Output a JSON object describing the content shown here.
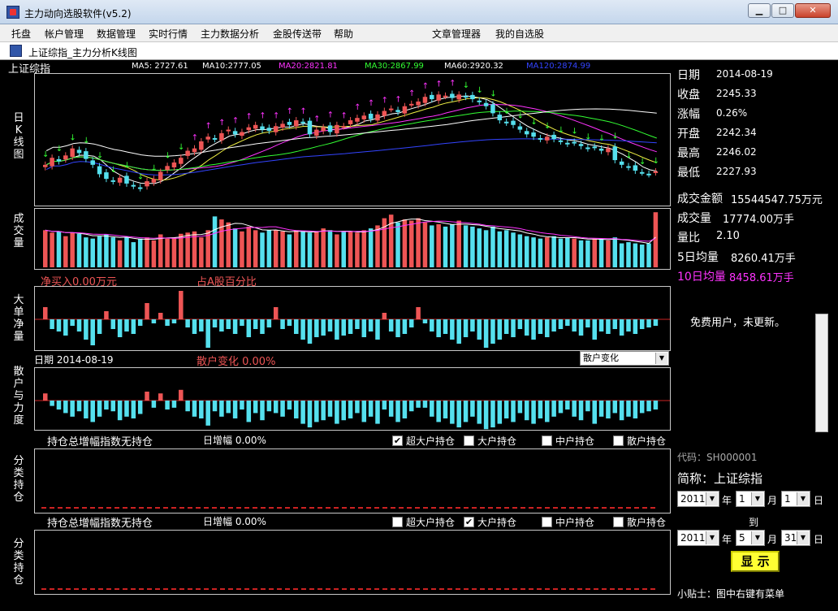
{
  "window": {
    "title": "主力动向选股软件(v5.2)",
    "min": "▁",
    "max": "□",
    "close": "✕"
  },
  "menu": [
    "托盘",
    "帐户管理",
    "数据管理",
    "实时行情",
    "主力数据分析",
    "金股传送带",
    "帮助",
    "文章管理器",
    "我的自选股"
  ],
  "subtitle": "上证综指_主力分析K线图",
  "stock_name": "上证综指",
  "ma": [
    {
      "label": "MA5: 2727.61",
      "color": "#ffffff"
    },
    {
      "label": "MA10:2777.05",
      "color": "#ffffff"
    },
    {
      "label": "MA20:2821.81",
      "color": "#ff33ff"
    },
    {
      "label": "MA30:2867.99",
      "color": "#33ff33"
    },
    {
      "label": "MA60:2920.32",
      "color": "#ffffff"
    },
    {
      "label": "MA120:2874.99",
      "color": "#3344ff"
    }
  ],
  "labels": {
    "kline": "日K线图",
    "volume": "成交量",
    "bignet": "大单净量",
    "retail": "散户与力度",
    "hold1": "分类持仓",
    "hold2": "分类持仓",
    "net_buy": "净买入0.00万元",
    "pct_a": "占A股百分比",
    "date_label": "日期 2014-08-19",
    "retail_change": "散户变化  0.00%",
    "retail_dropdown": "散户变化",
    "hold_title": "持仓总增幅指数无持仓",
    "day_inc": "日增幅  0.00%",
    "chk_super": "超大户持仓",
    "chk_big": "大户持仓",
    "chk_mid": "中户持仓",
    "chk_retail": "散户持仓",
    "chk1": [
      true,
      false,
      false,
      false
    ],
    "chk2": [
      false,
      true,
      false,
      false
    ]
  },
  "colors": {
    "up": "#ee5555",
    "down": "#55e0ee",
    "ma5": "#ffffff",
    "ma10": "#eeee44",
    "ma20": "#ff33ff",
    "ma30": "#33ff33",
    "ma60": "#ffffff",
    "ma120": "#3344ff",
    "buy": "#ff33ff",
    "sell": "#33ff33"
  },
  "side": {
    "rows": [
      {
        "k": "日期",
        "v": "2014-08-19"
      },
      {
        "k": "收盘",
        "v": "2245.33"
      },
      {
        "k": "涨幅",
        "v": "0.26%"
      },
      {
        "k": "开盘",
        "v": "2242.34"
      },
      {
        "k": "最高",
        "v": "2246.02"
      },
      {
        "k": "最低",
        "v": "2227.93"
      }
    ],
    "rows2": [
      {
        "k": "成交金额",
        "v": "15544547.75万元"
      },
      {
        "k": "成交量",
        "v": "17774.00万手"
      },
      {
        "k": "量比",
        "v": "2.10"
      },
      {
        "k": "5日均量",
        "v": "8260.41万手"
      },
      {
        "k": "10日均量",
        "v": "8458.61万手"
      }
    ],
    "notice": "免费用户，未更新。",
    "code": "代码：SH000001",
    "short_name": "简称：上证综指",
    "from": {
      "y": "2011",
      "m": "1",
      "d": "1"
    },
    "to": {
      "y": "2011",
      "m": "5",
      "d": "31"
    },
    "to_label": "到",
    "y": "年",
    "mo": "月",
    "d": "日",
    "show_btn": "显 示",
    "tip": "小贴士：图中右键有菜单"
  },
  "chart_data": {
    "type": "candlestick",
    "k_series_close": [
      2760,
      2790,
      2775,
      2800,
      2830,
      2810,
      2785,
      2760,
      2720,
      2700,
      2690,
      2705,
      2680,
      2670,
      2660,
      2690,
      2700,
      2730,
      2755,
      2770,
      2790,
      2820,
      2830,
      2860,
      2880,
      2870,
      2895,
      2910,
      2890,
      2900,
      2920,
      2930,
      2910,
      2905,
      2925,
      2935,
      2930,
      2950,
      2940,
      2890,
      2910,
      2920,
      2900,
      2930,
      2925,
      2950,
      2960,
      2970,
      2955,
      2975,
      2990,
      3000,
      2985,
      3010,
      3020,
      3030,
      3050,
      3040,
      3060,
      3055,
      3045,
      3060,
      3050,
      3040,
      3030,
      3010,
      2980,
      2950,
      2940,
      2930,
      2910,
      2890,
      2880,
      2870,
      2880,
      2870,
      2860,
      2850,
      2855,
      2840,
      2830,
      2835,
      2820,
      2830,
      2780,
      2760,
      2750,
      2735,
      2728,
      2720,
      2732
    ],
    "vol_series": [
      62,
      58,
      60,
      52,
      58,
      56,
      50,
      48,
      52,
      55,
      50,
      45,
      50,
      42,
      48,
      50,
      45,
      55,
      48,
      50,
      56,
      58,
      60,
      50,
      62,
      85,
      80,
      75,
      65,
      60,
      68,
      62,
      58,
      62,
      62,
      60,
      55,
      62,
      60,
      58,
      60,
      65,
      62,
      55,
      60,
      60,
      58,
      62,
      65,
      70,
      82,
      88,
      75,
      80,
      78,
      82,
      75,
      70,
      72,
      68,
      72,
      78,
      70,
      68,
      65,
      62,
      68,
      60,
      62,
      58,
      55,
      52,
      50,
      48,
      50,
      52,
      48,
      50,
      48,
      45,
      45,
      48,
      48,
      45,
      50,
      40,
      42,
      40,
      38,
      40,
      92
    ],
    "bignet_series": [
      15,
      -12,
      -15,
      -20,
      -8,
      -15,
      -25,
      -32,
      -18,
      10,
      -12,
      -22,
      -15,
      -18,
      -8,
      20,
      -5,
      8,
      -8,
      -5,
      35,
      -10,
      -18,
      -15,
      -35,
      -10,
      -15,
      -12,
      -18,
      -8,
      -22,
      -12,
      -18,
      -10,
      15,
      -12,
      -8,
      -18,
      -25,
      -30,
      -22,
      -20,
      -15,
      -25,
      -20,
      -18,
      -12,
      -22,
      -15,
      -25,
      8,
      -15,
      -22,
      -18,
      -10,
      15,
      -5,
      -15,
      -22,
      -18,
      -25,
      -30,
      -22,
      -15,
      -25,
      -35,
      -30,
      -25,
      -18,
      -22,
      -12,
      -20,
      -25,
      -18,
      -22,
      -15,
      -12,
      -8,
      -15,
      -20,
      -10,
      -25,
      -15,
      -18,
      -12,
      -20,
      -15,
      -18,
      -12,
      -10,
      -8
    ],
    "retail_series": [
      8,
      -6,
      -10,
      -14,
      -18,
      -12,
      -20,
      -24,
      -18,
      -10,
      -12,
      -22,
      -18,
      -20,
      -15,
      10,
      -8,
      8,
      -10,
      -8,
      12,
      -12,
      -18,
      -20,
      -28,
      -12,
      -18,
      -14,
      -20,
      -10,
      -24,
      -14,
      -22,
      -12,
      -14,
      -18,
      -10,
      -20,
      -26,
      -30,
      -24,
      -22,
      -18,
      -26,
      -22,
      -20,
      -14,
      -24,
      -18,
      -26,
      -10,
      -18,
      -24,
      -20,
      -12,
      -8,
      -8,
      -18,
      -24,
      -20,
      -26,
      -30,
      -24,
      -18,
      -26,
      -32,
      -30,
      -26,
      -20,
      -24,
      -14,
      -22,
      -26,
      -20,
      -24,
      -18,
      -14,
      -10,
      -18,
      -22,
      -12,
      -26,
      -18,
      -20,
      -14,
      -22,
      -18,
      -20,
      -14,
      -12,
      -10
    ]
  }
}
